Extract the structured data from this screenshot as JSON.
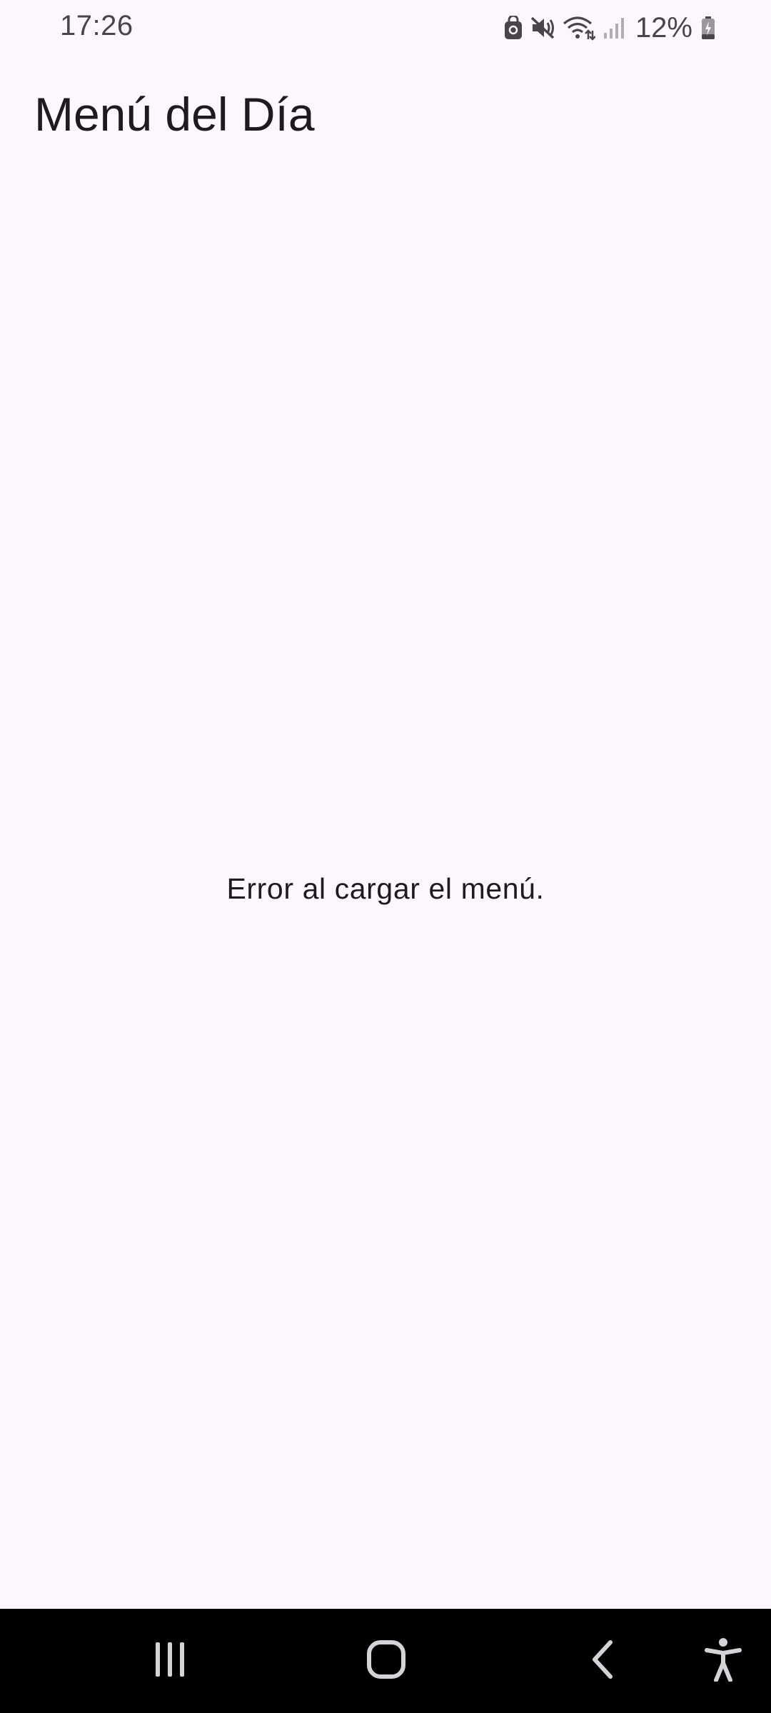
{
  "status_bar": {
    "time": "17:26",
    "battery_percent": "12%",
    "icons": [
      "vpn-lock-icon",
      "mute-icon",
      "wifi-icon",
      "cellular-signal-icon",
      "battery-charging-icon"
    ]
  },
  "app_bar": {
    "title": "Menú del Día"
  },
  "content": {
    "error_message": "Error al cargar el menú."
  },
  "nav_bar": {
    "buttons": [
      "recent-apps-icon",
      "home-icon",
      "back-icon",
      "accessibility-icon"
    ]
  },
  "colors": {
    "background": "#fdf7fd",
    "text": "#1d1b20",
    "status_text": "#48464c",
    "nav_background": "#000000"
  }
}
